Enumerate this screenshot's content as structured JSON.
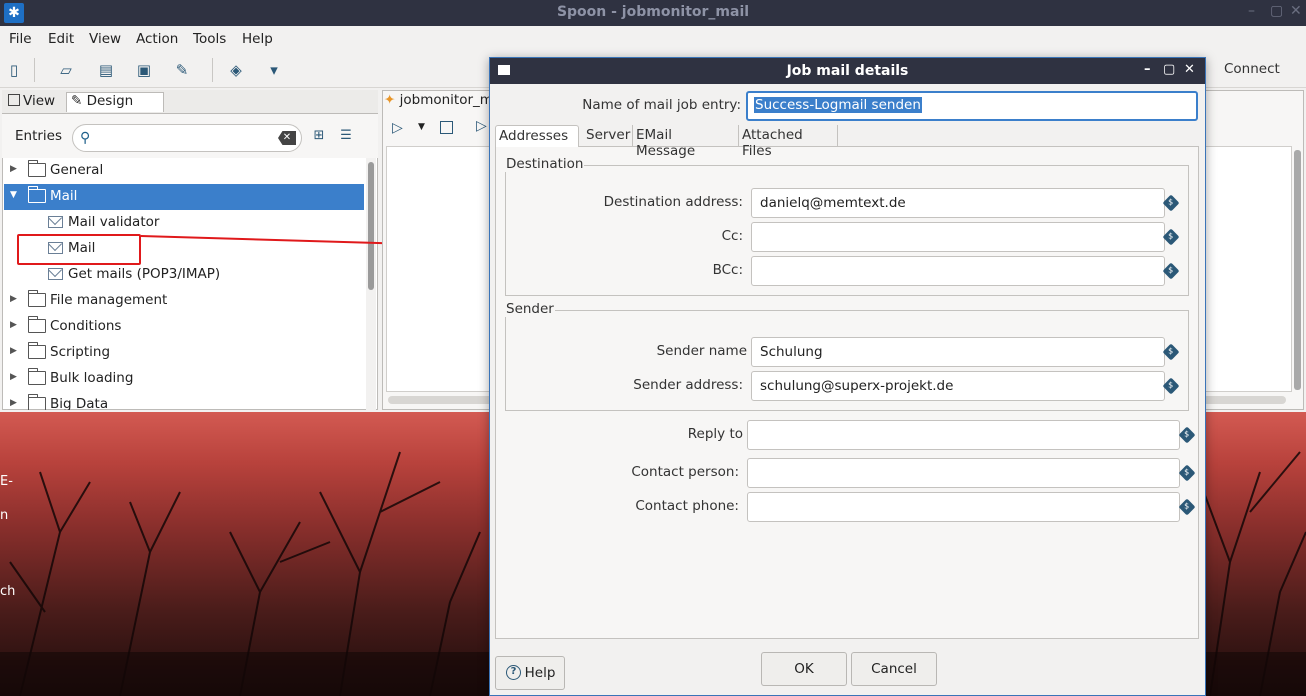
{
  "window": {
    "title": "Spoon - jobmonitor_mail",
    "controls": [
      "–",
      "▢",
      "✕"
    ]
  },
  "menubar": [
    "File",
    "Edit",
    "View",
    "Action",
    "Tools",
    "Help"
  ],
  "toolbar": {
    "connect_label": "Connect"
  },
  "left_panel": {
    "tab_view": "View",
    "tab_design": "Design",
    "entries_label": "Entries",
    "search_placeholder": "",
    "tree": [
      {
        "label": "General",
        "type": "folder",
        "expanded": false
      },
      {
        "label": "Mail",
        "type": "folder",
        "expanded": true,
        "selected": true
      },
      {
        "label": "Mail validator",
        "type": "entry"
      },
      {
        "label": "Mail",
        "type": "entry",
        "highlighted": true
      },
      {
        "label": "Get mails (POP3/IMAP)",
        "type": "entry"
      },
      {
        "label": "File management",
        "type": "folder",
        "expanded": false
      },
      {
        "label": "Conditions",
        "type": "folder",
        "expanded": false
      },
      {
        "label": "Scripting",
        "type": "folder",
        "expanded": false
      },
      {
        "label": "Bulk loading",
        "type": "folder",
        "expanded": false
      },
      {
        "label": "Big Data",
        "type": "folder",
        "expanded": false
      }
    ]
  },
  "editor": {
    "tab_label": "jobmonitor_m"
  },
  "desktop": {
    "fragments": [
      "E-",
      "n",
      "ch"
    ]
  },
  "dialog": {
    "title": "Job mail details",
    "name_label": "Name of mail job entry:",
    "name_value": "Success-Logmail senden",
    "tabs": [
      "Addresses",
      "Server",
      "EMail Message",
      "Attached Files"
    ],
    "destination": {
      "group_title": "Destination",
      "destination_label": "Destination address:",
      "destination_value": "danielq@memtext.de",
      "cc_label": "Cc:",
      "cc_value": "",
      "bcc_label": "BCc:",
      "bcc_value": ""
    },
    "sender": {
      "group_title": "Sender",
      "name_label": "Sender name",
      "name_value": "Schulung",
      "address_label": "Sender address:",
      "address_value": "schulung@superx-projekt.de"
    },
    "reply_to_label": "Reply to",
    "reply_to_value": "",
    "contact_person_label": "Contact person:",
    "contact_person_value": "",
    "contact_phone_label": "Contact phone:",
    "contact_phone_value": "",
    "help_label": "Help",
    "ok_label": "OK",
    "cancel_label": "Cancel",
    "var_symbol": "$"
  },
  "colors": {
    "selection": "#3b7fcb",
    "titlebar": "#2f3241",
    "highlight_red": "#e0191b"
  }
}
